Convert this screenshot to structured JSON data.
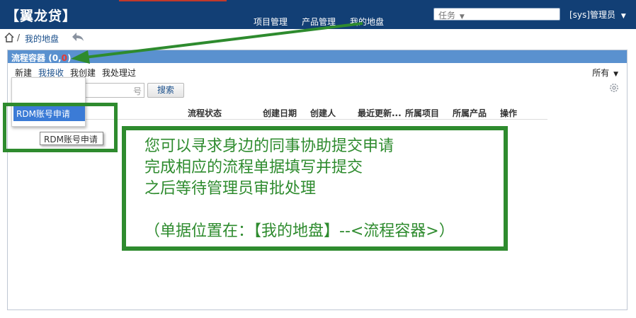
{
  "app": {
    "logo": "【翼龙贷】"
  },
  "nav": [
    {
      "label": "项目管理"
    },
    {
      "label": "产品管理"
    },
    {
      "label": "我的地盘"
    }
  ],
  "search": {
    "placeholder": "任务"
  },
  "user": {
    "label": "[sys]管理员"
  },
  "breadcrumb": {
    "separator": "/",
    "current": "我的地盘"
  },
  "panel": {
    "title": "流程容器",
    "count_open": "(0,",
    "count_red": "0",
    "count_close": ")",
    "tabs": [
      "新建",
      "我接收",
      "我创建",
      "我处理过"
    ],
    "filter": "所有",
    "search_input_value": "号",
    "search_button": "搜索",
    "columns": [
      "流程状态",
      "创建日期",
      "创建人",
      "最近更新...",
      "所属项目",
      "所属产品",
      "操作"
    ]
  },
  "dropdown": {
    "item": "RDM账号申请"
  },
  "tooltip": {
    "text": "RDM账号申请"
  },
  "annotation": {
    "lines": [
      "您可以寻求身边的同事协助提交申请",
      "完成相应的流程单据填写并提交",
      "之后等待管理员审批处理",
      "",
      "（单据位置在：【我的地盘】--<流程容器>）"
    ]
  },
  "colors": {
    "topbar": "#123f75",
    "panel_head": "#5a91cf",
    "annotation": "#2e8b2e",
    "highlight": "#3b7bd6"
  },
  "icons": [
    "home-icon",
    "back-icon",
    "gear-icon",
    "caret-down-icon"
  ]
}
